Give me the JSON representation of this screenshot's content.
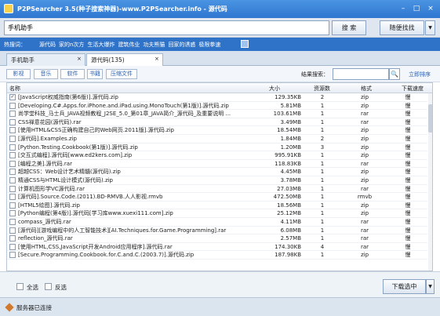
{
  "window": {
    "title": "P2PSearcher 3.5(种子搜索神器)-www.P2PSearcher.info - 源代码",
    "icon": "app-icon",
    "controls": {
      "minimize": "–",
      "maximize": "□",
      "close": "×"
    }
  },
  "search": {
    "query": "手机助手",
    "button": "搜 索",
    "random_button": "随便找找",
    "random_arrow": "▼"
  },
  "hot": {
    "label": "热搜词：",
    "items": [
      "源代码",
      "家的n次方",
      "生活大爆炸",
      "建筑伟业",
      "功夫熊猫",
      "回家的诱惑",
      "极限拳速"
    ]
  },
  "tabs": [
    {
      "label": "手机助手",
      "close": "×"
    },
    {
      "label": "源代码(135)",
      "close": "×"
    }
  ],
  "filters": [
    "影视",
    "音乐",
    "软件",
    "书籍",
    "压缩文件"
  ],
  "result_search": {
    "label": "结果搜索：",
    "value": "",
    "icon": "🔍",
    "sort_link": "立即排序"
  },
  "columns": {
    "name": "名称",
    "size": "大小",
    "sources": "资源数",
    "format": "格式",
    "speed": "下载速度"
  },
  "rows": [
    {
      "checked": true,
      "name": "[JavaScript权威指南(第6版)].源代码.zip",
      "size": "129.35KB",
      "sources": "2",
      "format": "zip",
      "speed": "慢"
    },
    {
      "checked": false,
      "name": "[Developing.C#.Apps.for.iPhone.and.iPad.using.MonoTouch(第1版)].源代码.zip",
      "size": "5.81MB",
      "sources": "1",
      "format": "zip",
      "speed": "慢"
    },
    {
      "checked": false,
      "name": "尚学堂科技_马士兵_JAVA视频教程_J2SE_5.0_第01章_JAVA简介_源代码_及重要说明 ...",
      "size": "103.61MB",
      "sources": "1",
      "format": "rar",
      "speed": "慢"
    },
    {
      "checked": false,
      "name": "CSS禅意花园(源代码).rar",
      "size": "3.49MB",
      "sources": "1",
      "format": "rar",
      "speed": "慢"
    },
    {
      "checked": false,
      "name": "[使用HTML&CSS正确构建自己的Web网页.2011版].源代码.zip",
      "size": "18.54MB",
      "sources": "1",
      "format": "zip",
      "speed": "慢"
    },
    {
      "checked": false,
      "name": "[源代码].Examples.zip",
      "size": "1.84MB",
      "sources": "2",
      "format": "zip",
      "speed": "慢"
    },
    {
      "checked": false,
      "name": "[Python.Testing.Cookbook(第1版)].源代码.zip",
      "size": "1.20MB",
      "sources": "3",
      "format": "zip",
      "speed": "慢"
    },
    {
      "checked": false,
      "name": "[交互式编程].源代码[www.ed2kers.com].zip",
      "size": "995.91KB",
      "sources": "1",
      "format": "zip",
      "speed": "慢"
    },
    {
      "checked": false,
      "name": "[编程之美].源代码.rar",
      "size": "118.83KB",
      "sources": "1",
      "format": "rar",
      "speed": "慢"
    },
    {
      "checked": false,
      "name": "超越CSS：Web设计艺术精髓(源代码).zip",
      "size": "4.45MB",
      "sources": "1",
      "format": "zip",
      "speed": "慢"
    },
    {
      "checked": false,
      "name": "精通CSS与HTML设计模式(源代码).zip",
      "size": "3.78MB",
      "sources": "1",
      "format": "zip",
      "speed": "慢"
    },
    {
      "checked": false,
      "name": "计算机图形学VC源代码.rar",
      "size": "27.03MB",
      "sources": "1",
      "format": "rar",
      "speed": "慢"
    },
    {
      "checked": false,
      "name": "[源代码].Source.Code.(2011).BD-RMVB.人人影视.rmvb",
      "size": "472.50MB",
      "sources": "1",
      "format": "rmvb",
      "speed": "慢"
    },
    {
      "checked": false,
      "name": "[HTML5绘图].源代码.zip",
      "size": "18.56MB",
      "sources": "1",
      "format": "zip",
      "speed": "慢"
    },
    {
      "checked": false,
      "name": "[Python编程(第4版)].源代码[学习库www.xuexi111.com].zip",
      "size": "25.12MB",
      "sources": "1",
      "format": "zip",
      "speed": "慢"
    },
    {
      "checked": false,
      "name": "compass_源代码.rar",
      "size": "4.11MB",
      "sources": "1",
      "format": "rar",
      "speed": "慢"
    },
    {
      "checked": false,
      "name": "[源代码][游戏编程中的人工智能技术][AI.Techniques.for.Game.Programming].rar",
      "size": "6.08MB",
      "sources": "1",
      "format": "rar",
      "speed": "慢"
    },
    {
      "checked": false,
      "name": "reflection_源代码.rar",
      "size": "2.57MB",
      "sources": "1",
      "format": "rar",
      "speed": "慢"
    },
    {
      "checked": false,
      "name": "[使用HTML,CSS,JavaScript开发Android应用程序].源代码.rar",
      "size": "174.30KB",
      "sources": "4",
      "format": "rar",
      "speed": "慢"
    },
    {
      "checked": false,
      "name": "[Secure.Programming.Cookbook.for.C.and.C.(2003.7)].源代码.zip",
      "size": "187.98KB",
      "sources": "1",
      "format": "zip",
      "speed": "慢"
    }
  ],
  "bottom": {
    "select_all": "全选",
    "invert": "反选",
    "download_button": "下载选中",
    "download_arrow": "▼"
  },
  "status": {
    "text": "服务器已连接"
  },
  "colors": {
    "titlebar": "#3a86db",
    "hotbar": "#2f73c8",
    "link": "#2a5fb0"
  }
}
